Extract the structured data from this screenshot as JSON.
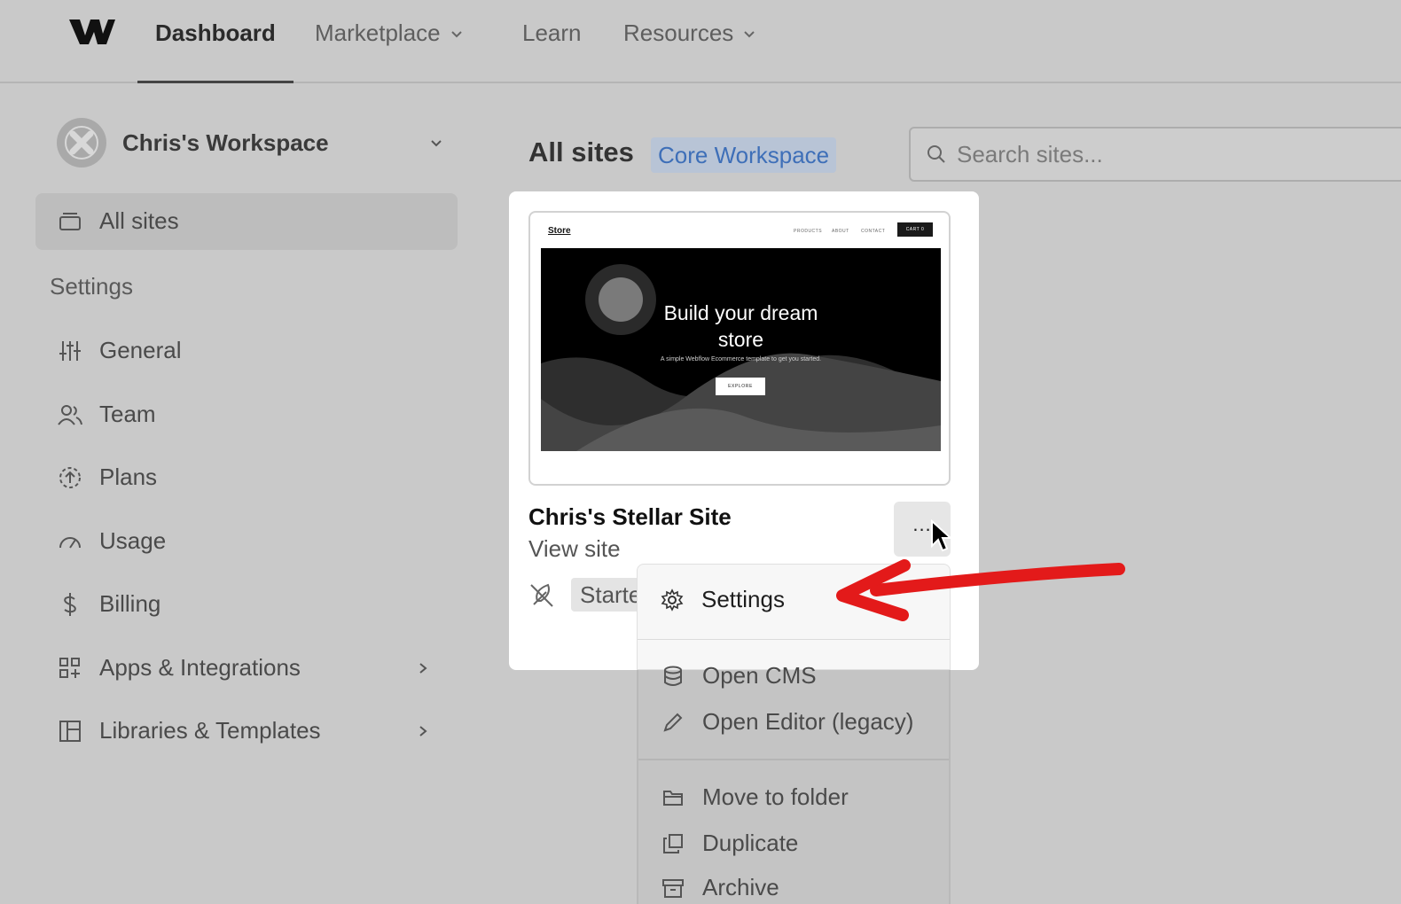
{
  "nav": {
    "items": [
      {
        "label": "Dashboard",
        "active": true
      },
      {
        "label": "Marketplace",
        "dropdown": true
      },
      {
        "label": "Learn"
      },
      {
        "label": "Resources",
        "dropdown": true
      }
    ]
  },
  "sidebar": {
    "workspace_name": "Chris's Workspace",
    "all_sites": "All sites",
    "settings_heading": "Settings",
    "items": [
      {
        "label": "General",
        "icon": "sliders-icon"
      },
      {
        "label": "Team",
        "icon": "users-icon"
      },
      {
        "label": "Plans",
        "icon": "plans-upgrade-icon"
      },
      {
        "label": "Usage",
        "icon": "gauge-icon"
      },
      {
        "label": "Billing",
        "icon": "dollar-icon"
      },
      {
        "label": "Apps & Integrations",
        "icon": "apps-icon",
        "has_submenu": true
      },
      {
        "label": "Libraries & Templates",
        "icon": "layout-icon",
        "has_submenu": true
      }
    ]
  },
  "main": {
    "title": "All sites",
    "workspace_badge": "Core Workspace",
    "search_placeholder": "Search sites..."
  },
  "site_card": {
    "thumbnail": {
      "store_label": "Store",
      "links": [
        "PRODUCTS",
        "ABOUT",
        "CONTACT"
      ],
      "cart_label": "CART 0",
      "hero_title_line1": "Build your dream",
      "hero_title_line2": "store",
      "hero_subtitle": "A simple Webflow Ecommerce template to get you started.",
      "hero_button": "EXPLORE"
    },
    "name": "Chris's Stellar Site",
    "view_site": "View site",
    "plan_badge": "Starte",
    "more_label": "..."
  },
  "context_menu": {
    "items": [
      {
        "label": "Settings",
        "icon": "gear-icon"
      },
      {
        "label": "Open CMS",
        "icon": "database-icon"
      },
      {
        "label": "Open Editor (legacy)",
        "icon": "pencil-icon"
      },
      {
        "label": "Move to folder",
        "icon": "folder-icon"
      },
      {
        "label": "Duplicate",
        "icon": "duplicate-icon"
      },
      {
        "label": "Archive",
        "icon": "archive-icon"
      }
    ]
  },
  "colors": {
    "overlay_bg": "#c9c9c9",
    "badge_text": "#3e6fb8",
    "annotation_arrow": "#e31a1a"
  }
}
